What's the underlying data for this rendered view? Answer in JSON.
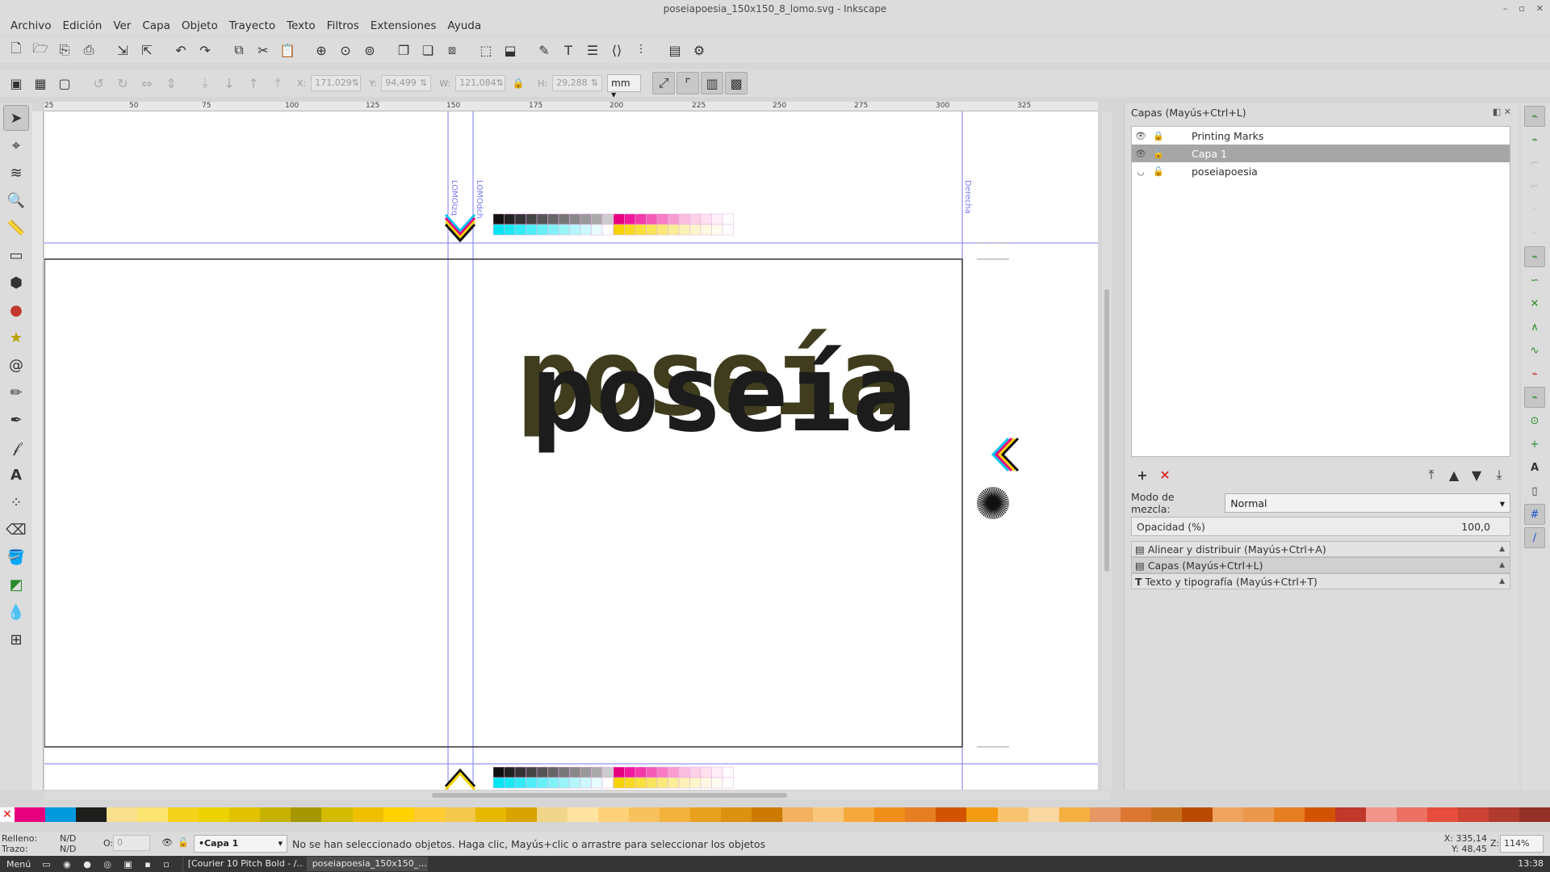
{
  "window": {
    "title": "poseiapoesia_150x150_8_lomo.svg - Inkscape"
  },
  "menus": [
    "Archivo",
    "Edición",
    "Ver",
    "Capa",
    "Objeto",
    "Trayecto",
    "Texto",
    "Filtros",
    "Extensiones",
    "Ayuda"
  ],
  "controls": {
    "x_label": "X:",
    "x_value": "171,029",
    "y_label": "Y:",
    "y_value": "94,499",
    "w_label": "W:",
    "w_value": "121,084",
    "h_label": "H:",
    "h_value": "29,288",
    "unit": "mm"
  },
  "ruler": {
    "labels": [
      "25",
      "50",
      "75",
      "100",
      "125",
      "150",
      "175",
      "200",
      "225",
      "250",
      "275",
      "300",
      "325"
    ]
  },
  "canvas": {
    "artwork_text": "poseía",
    "guide_labels": [
      "LOMOIzq",
      "LOMOdch",
      "Derecha"
    ]
  },
  "layers_panel": {
    "title": "Capas (Mayús+Ctrl+L)",
    "layers": [
      {
        "name": "Printing Marks",
        "selected": false
      },
      {
        "name": "Capa 1",
        "selected": true
      },
      {
        "name": "poseiapoesia",
        "selected": false
      }
    ],
    "blend_label": "Modo de mezcla:",
    "blend_value": "Normal",
    "opacity_label": "Opacidad (%)",
    "opacity_value": "100,0"
  },
  "docks": [
    {
      "label": "Alinear y distribuir (Mayús+Ctrl+A)",
      "open": false
    },
    {
      "label": "Capas (Mayús+Ctrl+L)",
      "open": true
    },
    {
      "label": "Texto y tipografía (Mayús+Ctrl+T)",
      "open": false
    }
  ],
  "status": {
    "fill_label": "Relleno:",
    "fill_value": "N/D",
    "stroke_label": "Trazo:",
    "stroke_value": "N/D",
    "o_label": "O:",
    "o_value": "0",
    "layer": "•Capa 1",
    "message": "No se han seleccionado objetos. Haga clic, Mayús+clic o arrastre para seleccionar los objetos",
    "x_coord": "X: 335,14",
    "y_coord": "Y: 48,45",
    "zoom_label": "Z:",
    "zoom_value": "114%"
  },
  "taskbar": {
    "menu": "Menú",
    "apps": [
      "[Courier 10 Pitch Bold - /...",
      "poseiapoesia_150x150_..."
    ],
    "clock": "13:38"
  },
  "colors": {
    "accent_guide": "#7b7bf0",
    "palette": [
      "#e6007e",
      "#0099dd",
      "#1d1d1b",
      "#f8e08e",
      "#fbe36f",
      "#f5d21c",
      "#ecd200",
      "#e2c200",
      "#c7b200",
      "#a49700",
      "#d4ba00",
      "#f0c000",
      "#ffd200",
      "#ffcc33",
      "#f2c94c",
      "#e6b800",
      "#d9a300",
      "#f0d68a",
      "#ffe3a0",
      "#ffd27a",
      "#f7c15c",
      "#f2b23c",
      "#e8a11f",
      "#dd9111",
      "#cc7a00",
      "#f3b262",
      "#f9c77c",
      "#f6a93b",
      "#ef8f19",
      "#e67e22",
      "#d35400",
      "#f39c12",
      "#f8c471",
      "#fad7a0",
      "#f5b041",
      "#e59866",
      "#dc7633",
      "#ca6f1e",
      "#ba4a00",
      "#f0a35e",
      "#eb984e",
      "#e67e22",
      "#d35400",
      "#c0392b",
      "#f1948a",
      "#ec7063",
      "#e74c3c",
      "#cb4335",
      "#b03a2e",
      "#943126"
    ]
  }
}
